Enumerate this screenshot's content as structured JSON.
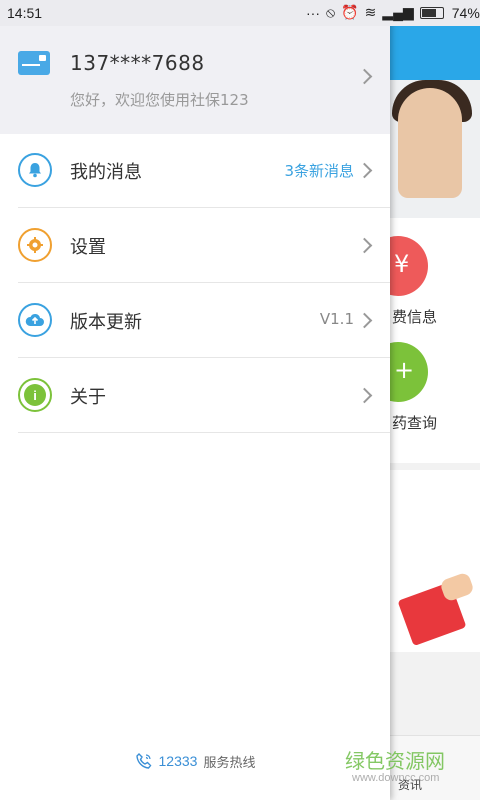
{
  "status_bar": {
    "time": "14:51",
    "battery": "74%"
  },
  "profile": {
    "phone": "137****7688",
    "welcome": "您好，欢迎您使用社保123"
  },
  "menu": [
    {
      "label": "我的消息",
      "value": "3条新消息",
      "icon": "bell-icon",
      "color": "#3aa2e0"
    },
    {
      "label": "设置",
      "value": "",
      "icon": "gear-icon",
      "color": "#f0a030"
    },
    {
      "label": "版本更新",
      "value": "V1.1",
      "icon": "cloud-upload-icon",
      "color": "#3aa2e0"
    },
    {
      "label": "关于",
      "value": "",
      "icon": "info-icon",
      "color": "#7cc23a"
    }
  ],
  "hotline": {
    "number": "12333",
    "label": "服务热线"
  },
  "background": {
    "labels": [
      "费信息",
      "药查询",
      "资讯"
    ],
    "watermark": "绿色资源网",
    "watermark_sub": "www.downcc.com"
  },
  "colors": {
    "accent": "#3aa2e0",
    "value_muted": "#888888"
  }
}
